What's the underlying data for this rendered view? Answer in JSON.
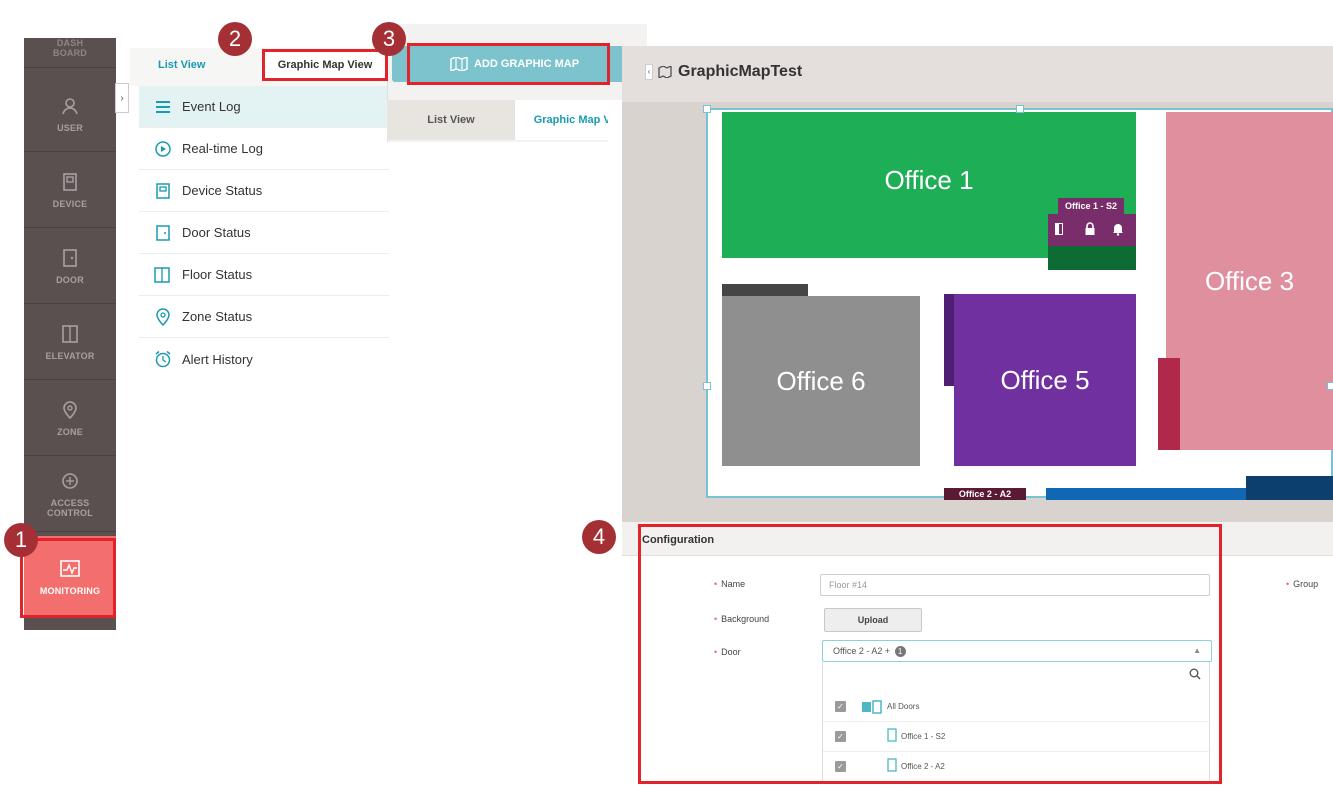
{
  "sidebar": {
    "items": [
      {
        "label": "DASH\nBOARD",
        "icon": "dashboard-icon"
      },
      {
        "label": "USER",
        "icon": "user-icon"
      },
      {
        "label": "DEVICE",
        "icon": "device-icon"
      },
      {
        "label": "DOOR",
        "icon": "door-icon"
      },
      {
        "label": "ELEVATOR",
        "icon": "elevator-icon"
      },
      {
        "label": "ZONE",
        "icon": "zone-icon"
      },
      {
        "label": "ACCESS\nCONTROL",
        "icon": "access-control-icon"
      },
      {
        "label": "MONITORING",
        "icon": "monitoring-icon"
      }
    ],
    "active_color": "#f26f6d"
  },
  "menu": {
    "tabs": [
      {
        "label": "List View"
      },
      {
        "label": "Graphic Map View"
      }
    ],
    "items": [
      {
        "label": "Event Log",
        "icon": "list-icon"
      },
      {
        "label": "Real-time Log",
        "icon": "play-icon"
      },
      {
        "label": "Device Status",
        "icon": "device-icon"
      },
      {
        "label": "Door Status",
        "icon": "door-icon"
      },
      {
        "label": "Floor Status",
        "icon": "floor-icon"
      },
      {
        "label": "Zone Status",
        "icon": "zone-icon"
      },
      {
        "label": "Alert History",
        "icon": "alarm-clock-icon"
      }
    ]
  },
  "graphic_map": {
    "add_button_label": "ADD GRAPHIC MAP",
    "tabs": [
      {
        "label": "List View"
      },
      {
        "label": "Graphic Map View"
      }
    ]
  },
  "main": {
    "title": "GraphicMapTest",
    "rooms": [
      {
        "label": "Office 1",
        "color": "#1eae56"
      },
      {
        "label": "Office 3",
        "color": "#e08f9f"
      },
      {
        "label": "Office 6",
        "color": "#8f8f8f"
      },
      {
        "label": "Office 5",
        "color": "#7030a0"
      }
    ],
    "door_tags": [
      {
        "label": "Office 1 - S2"
      },
      {
        "label": "Office 2 - A2"
      }
    ]
  },
  "config": {
    "title": "Configuration",
    "name_label": "Name",
    "name_value": "Floor #14",
    "group_label": "Group",
    "background_label": "Background",
    "upload_label": "Upload",
    "door_label": "Door",
    "door_value": "Office 2 - A2 +",
    "door_count": "1",
    "tree": [
      {
        "label": "All Doors"
      },
      {
        "label": "Office 1 - S2"
      },
      {
        "label": "Office 2 - A2"
      }
    ]
  },
  "callouts": [
    "1",
    "2",
    "3",
    "4"
  ],
  "colors": {
    "accent": "#1a9bb0",
    "callout": "#a42f34",
    "highlight": "#e1242b"
  }
}
